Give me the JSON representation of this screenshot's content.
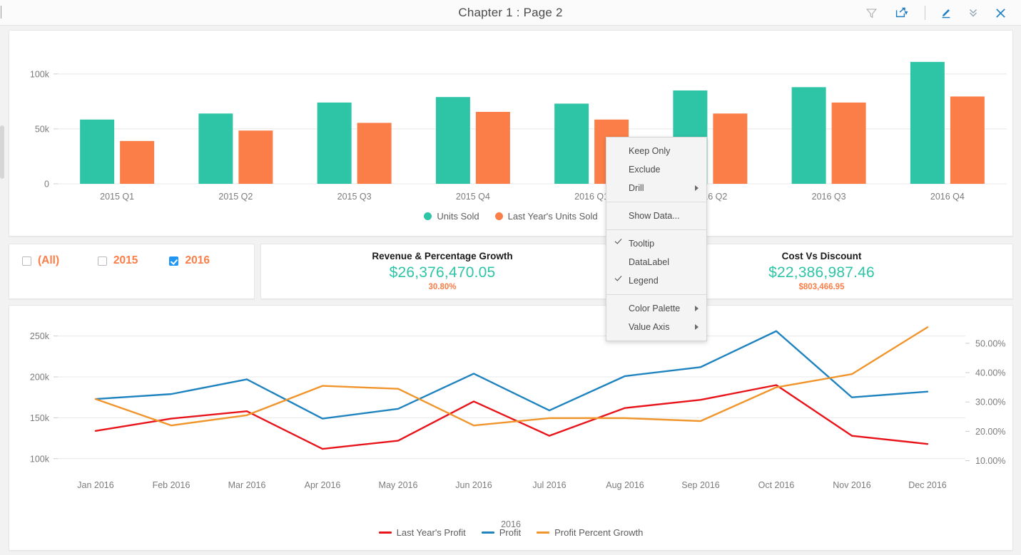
{
  "window": {
    "title": "Chapter 1 : Page 2",
    "icons": [
      {
        "name": "filter-icon",
        "glyph": "filter"
      },
      {
        "name": "share-icon",
        "glyph": "share"
      },
      {
        "name": "share-chevron-icon",
        "glyph": "chevron-down"
      },
      {
        "name": "edit-icon",
        "glyph": "pencil"
      },
      {
        "name": "collapse-icon",
        "glyph": "double-chevron-down"
      },
      {
        "name": "close-icon",
        "glyph": "close"
      }
    ]
  },
  "colors": {
    "teal": "#2ec4a6",
    "orange": "#fb7e48",
    "blue_line": "#1f83c0",
    "red_line": "#e8141a",
    "orange_line": "#f0952b",
    "accent_blue": "#1e7fc4",
    "grid": "#e8e8e8"
  },
  "context_menu": {
    "items": [
      {
        "label": "Keep Only",
        "checked": false,
        "submenu": false
      },
      {
        "label": "Exclude",
        "checked": false,
        "submenu": false
      },
      {
        "label": "Drill",
        "checked": false,
        "submenu": true
      },
      {
        "separator": true
      },
      {
        "label": "Show Data...",
        "checked": false,
        "submenu": false
      },
      {
        "separator": true
      },
      {
        "label": "Tooltip",
        "checked": true,
        "submenu": false
      },
      {
        "label": "DataLabel",
        "checked": false,
        "submenu": false
      },
      {
        "label": "Legend",
        "checked": true,
        "submenu": false
      },
      {
        "separator": true
      },
      {
        "label": "Color Palette",
        "checked": false,
        "submenu": true
      },
      {
        "label": "Value Axis",
        "checked": false,
        "submenu": true
      }
    ]
  },
  "filter": {
    "options": [
      {
        "label": "(All)",
        "checked": false
      },
      {
        "label": "2015",
        "checked": false
      },
      {
        "label": "2016",
        "checked": true
      }
    ]
  },
  "kpi": [
    {
      "title": "Revenue & Percentage Growth",
      "main": "$26,376,470.05",
      "sub": "30.80%"
    },
    {
      "title": "Cost Vs Discount",
      "main": "$22,386,987.46",
      "sub": "$803,466.95"
    }
  ],
  "chart_data": [
    {
      "type": "bar",
      "title": "",
      "xlabel": "",
      "ylabel": "",
      "categories": [
        "2015 Q1",
        "2015 Q2",
        "2015 Q3",
        "2015 Q4",
        "2016 Q1",
        "2016 Q2",
        "2016 Q3",
        "2016 Q4"
      ],
      "series": [
        {
          "name": "Units Sold",
          "color": "#2ec4a6",
          "values": [
            58500,
            64000,
            74000,
            79000,
            73000,
            85000,
            88000,
            111000
          ]
        },
        {
          "name": "Last Year's Units Sold",
          "color": "#fb7e48",
          "values": [
            39000,
            48500,
            55500,
            65500,
            58500,
            64000,
            74000,
            79500
          ]
        }
      ],
      "ytick_labels": [
        "0",
        "50k",
        "100k"
      ],
      "ytick_values": [
        0,
        50000,
        100000
      ],
      "ylim": [
        0,
        120000
      ],
      "grid": true,
      "legend_position": "bottom"
    },
    {
      "type": "line",
      "title": "",
      "xlabel": "2016",
      "categories": [
        "Jan 2016",
        "Feb 2016",
        "Mar 2016",
        "Apr 2016",
        "May 2016",
        "Jun 2016",
        "Jul 2016",
        "Aug 2016",
        "Sep 2016",
        "Oct 2016",
        "Nov 2016",
        "Dec 2016"
      ],
      "left_axis": {
        "tick_labels": [
          "100k",
          "150k",
          "200k",
          "250k"
        ],
        "tick_values": [
          100000,
          150000,
          200000,
          250000
        ],
        "ylim": [
          85000,
          268000
        ]
      },
      "right_axis": {
        "tick_labels": [
          "10.00%",
          "20.00%",
          "30.00%",
          "40.00%",
          "50.00%"
        ],
        "tick_values": [
          10,
          20,
          30,
          40,
          50
        ],
        "ylim": [
          6.5,
          57.5
        ]
      },
      "series": [
        {
          "name": "Last Year's Profit",
          "color": "#e8141a",
          "axis": "left",
          "values": [
            134000,
            149000,
            158000,
            112000,
            122000,
            170000,
            128000,
            162000,
            172000,
            190000,
            128000,
            118000
          ]
        },
        {
          "name": "Profit",
          "color": "#1f83c0",
          "axis": "left",
          "values": [
            173000,
            179000,
            197000,
            149000,
            161000,
            204000,
            159000,
            201000,
            212000,
            256000,
            175000,
            182000
          ]
        },
        {
          "name": "Profit Percent Growth",
          "color": "#f0952b",
          "axis": "right",
          "values": [
            31.0,
            22.0,
            25.5,
            35.5,
            34.5,
            22.0,
            24.5,
            24.5,
            23.5,
            35.0,
            39.5,
            55.5
          ]
        }
      ],
      "grid": true,
      "legend_position": "bottom"
    }
  ]
}
